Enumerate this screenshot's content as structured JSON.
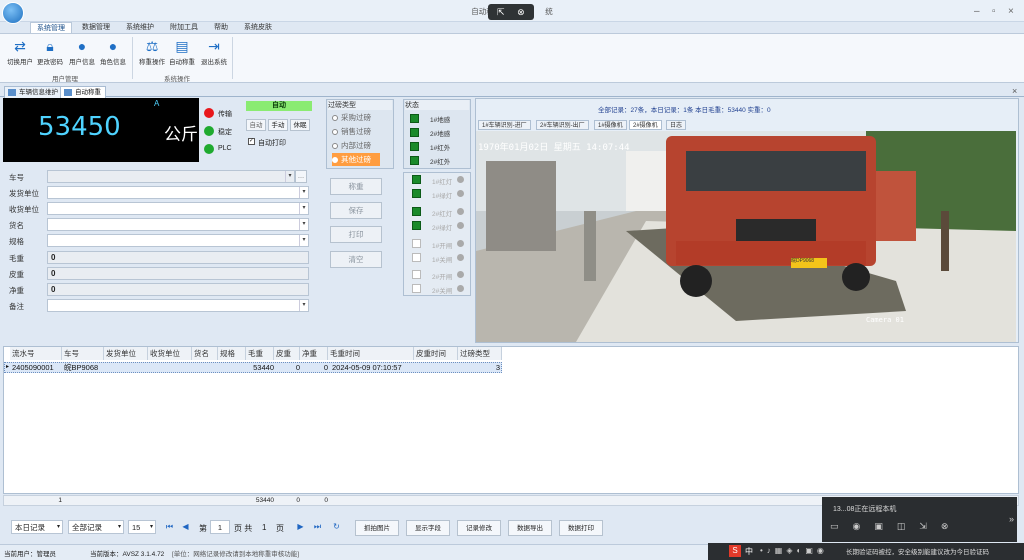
{
  "window": {
    "title": "自动称重",
    "title_suffix": "统"
  },
  "remote_bar": {
    "pin": "⇱",
    "close": "⊗"
  },
  "menu_tabs": [
    "系统管理",
    "数据管理",
    "系统维护",
    "附加工具",
    "帮助",
    "系统皮肤"
  ],
  "ribbon": {
    "user_group": {
      "label": "用户管理",
      "buttons": [
        "切换用户",
        "更改密码",
        "用户信息",
        "角色信息"
      ]
    },
    "sys_group": {
      "label": "系统操作",
      "buttons": [
        "称重操作",
        "自动称重",
        "退出系统"
      ]
    }
  },
  "doc_tabs": [
    "车辆信息维护",
    "自动称重"
  ],
  "display": {
    "weight": "53450",
    "unit": "公斤",
    "mark": "A"
  },
  "indicators": [
    {
      "label": "传输",
      "color": "#e8171b"
    },
    {
      "label": "稳定",
      "color": "#1faa2f"
    },
    {
      "label": "PLC",
      "color": "#1faa2f"
    }
  ],
  "mode": {
    "auto": "自动",
    "btn_auto": "自动",
    "btn_manual": "手动",
    "btn_rest": "休眠",
    "auto_print": "自动打印"
  },
  "form": {
    "plate": {
      "label": "车号",
      "value": ""
    },
    "sender": {
      "label": "发货单位",
      "value": ""
    },
    "receiver": {
      "label": "收货单位",
      "value": ""
    },
    "goods": {
      "label": "货名",
      "value": ""
    },
    "spec": {
      "label": "规格",
      "value": ""
    },
    "gross": {
      "label": "毛重",
      "value": "0"
    },
    "tare": {
      "label": "皮重",
      "value": "0"
    },
    "net": {
      "label": "净重",
      "value": "0"
    },
    "remark": {
      "label": "备注",
      "value": ""
    }
  },
  "weigh_type": {
    "title": "过磅类型",
    "options": [
      "采购过磅",
      "销售过磅",
      "内部过磅",
      "其他过磅"
    ],
    "selected": "其他过磅"
  },
  "actions": [
    "称重",
    "保存",
    "打印",
    "清空"
  ],
  "status_panel": {
    "title": "状态",
    "items": [
      "1#地感",
      "2#地感",
      "1#红外",
      "2#红外"
    ]
  },
  "lights": [
    "1#红灯",
    "1#绿灯",
    "2#红灯",
    "2#绿灯",
    "1#开闸",
    "1#关闸",
    "2#开闸",
    "2#关闸"
  ],
  "camera": {
    "summary": "全部记录：27条，本日记录：1条  本日毛重：53440  实重：0",
    "tabs": [
      "1#车辆识别-进厂",
      "2#车辆识别-出厂",
      "1#摄像机",
      "2#摄像机",
      "日志"
    ],
    "active_tab": "2#摄像机",
    "osd_time": "1970年01月02日 星期五 14:07:44",
    "osd_cam": "Camera 01",
    "plate": "皖DP9068"
  },
  "grid": {
    "headers": [
      "流水号",
      "车号",
      "发货单位",
      "收货单位",
      "货名",
      "规格",
      "毛重",
      "皮重",
      "净重",
      "毛重时间",
      "皮重时间",
      "过磅类型"
    ],
    "rows": [
      [
        "2405090001",
        "皖BP9068",
        "",
        "",
        "",
        "",
        "53440",
        "0",
        "0",
        "2024-05-09 07:10:57",
        "",
        "3"
      ]
    ],
    "summary": {
      "count": "1",
      "gross": "53440",
      "tare": "0",
      "net": "0"
    }
  },
  "pager": {
    "filter1": "本日记录",
    "filter2": "全部记录",
    "page_size": "15",
    "page_prefix": "第",
    "page": "1",
    "page_mid": "页  共",
    "total": "1",
    "page_suffix": "页"
  },
  "bottom_buttons": [
    "抓拍图片",
    "显示字段",
    "记录修改",
    "数据导出",
    "数据打印"
  ],
  "statusbar": {
    "user": "当前用户：管理员",
    "version": "当前版本：AVSZ 3.1.4.72",
    "notice": "[单位：网络记录修改请到本地称重审核功能]"
  },
  "notification": {
    "title": "13...08正在远程本机",
    "tail": "长期验证码被控，安全级别能建议改为今日验证码"
  },
  "taskbar": {
    "ime": "中"
  }
}
